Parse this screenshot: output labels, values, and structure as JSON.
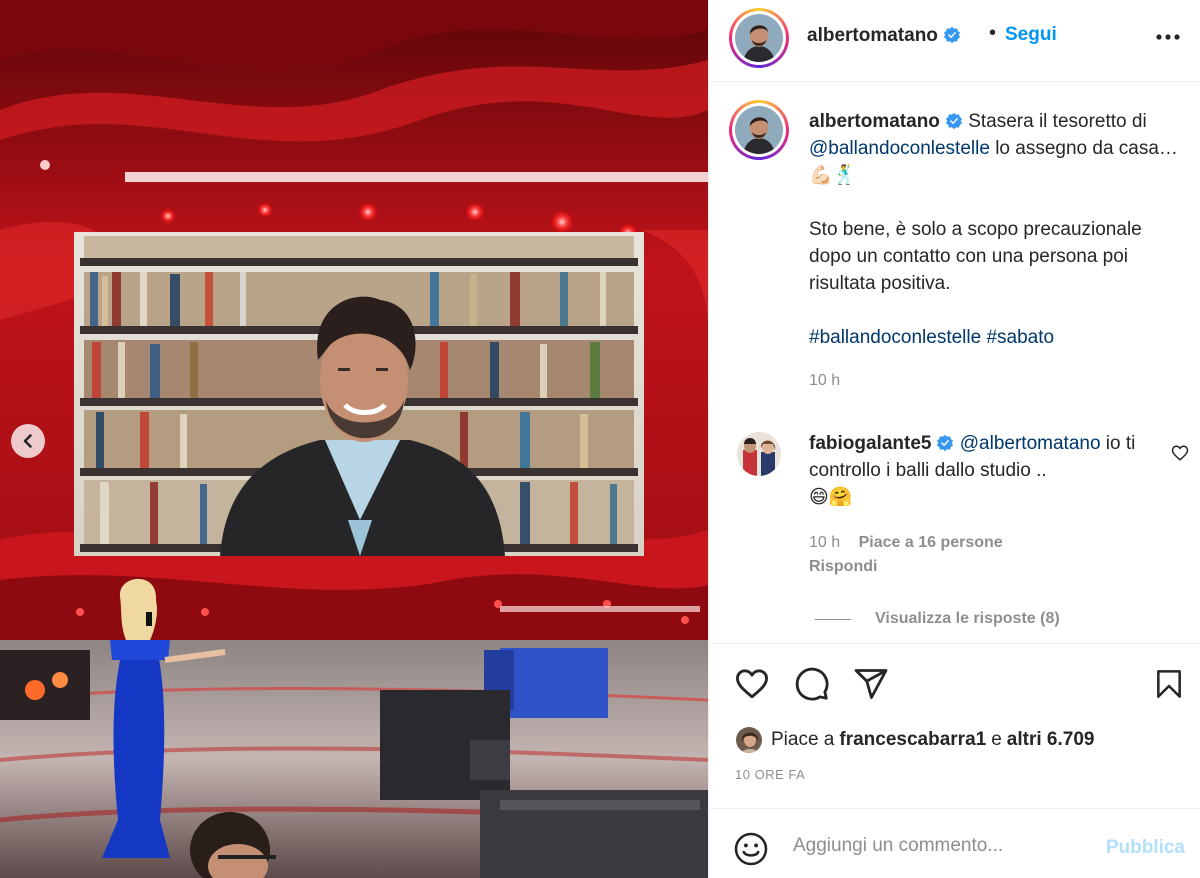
{
  "post": {
    "username": "albertomatano",
    "follow_label": "Segui",
    "dot": "•"
  },
  "caption": {
    "username": "albertomatano",
    "text_1": " Stasera il tesoretto di ",
    "mention": "@ballandoconlestelle",
    "text_2": " lo assegno da casa… 💪🏻🕺",
    "paragraph_2": "Sto bene, è solo a scopo precauzionale dopo un contatto con una persona poi risultata positiva.",
    "hashtag_1": "#ballandoconlestelle",
    "hashtag_2": "#sabato",
    "time": "10 h"
  },
  "comment": {
    "username": "fabiogalante5",
    "mention": "@albertomatano",
    "text": " io ti controllo i balli dallo studio ..",
    "emoji": "😄🤗",
    "time": "10 h",
    "likes": "Piace a 16 persone",
    "reply": "Rispondi",
    "view_replies": "Visualizza le risposte (8)"
  },
  "likes": {
    "prefix": "Piace a ",
    "user": "francescabarra1",
    "middle": " e ",
    "others": "altri 6.709"
  },
  "ago": "10 ORE FA",
  "input": {
    "placeholder": "Aggiungi un commento...",
    "publish": "Pubblica"
  },
  "colors": {
    "accent": "#0095f6",
    "verified": "#3897f0",
    "link": "#00376b",
    "muted": "#8e8e8e",
    "publish_disabled": "#b2dffc"
  },
  "icons": [
    "chevron-left-icon",
    "more-icon",
    "verified-icon",
    "heart-icon",
    "comment-icon",
    "share-icon",
    "bookmark-icon",
    "emoji-icon"
  ]
}
